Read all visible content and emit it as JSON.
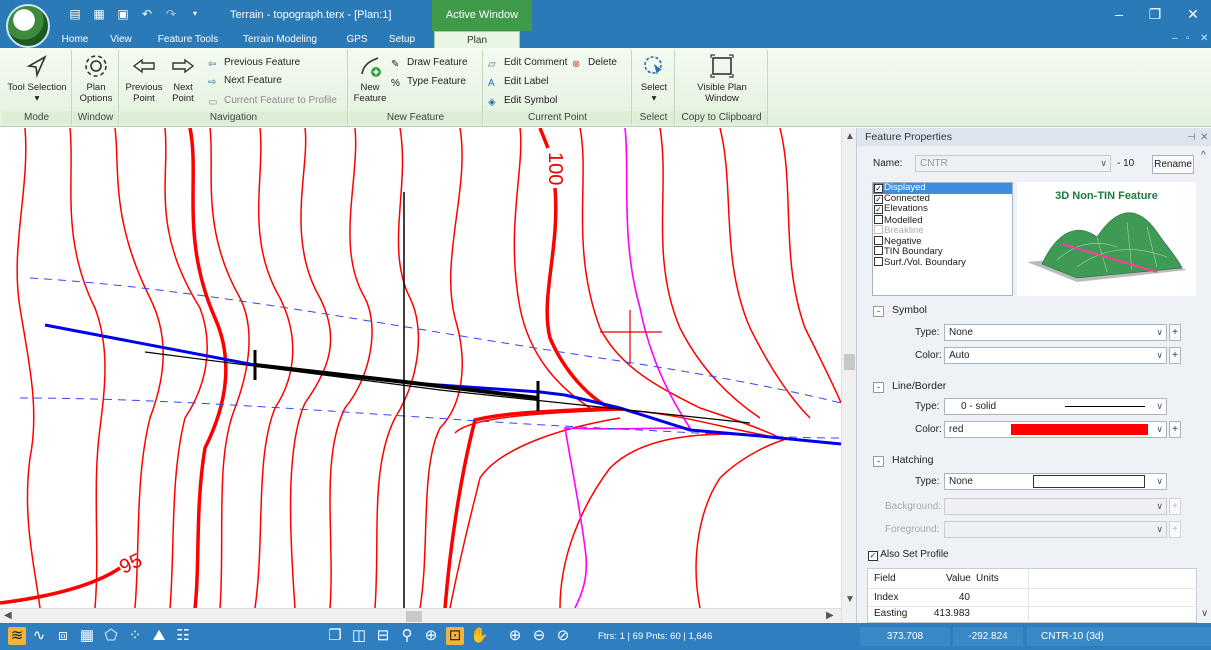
{
  "window": {
    "title": "Terrain - topograph.terx - [Plan:1]",
    "active_window_tab": "Active Window"
  },
  "ribbon_tabs": [
    {
      "label": "Home"
    },
    {
      "label": "View"
    },
    {
      "label": "Feature Tools"
    },
    {
      "label": "Terrain Modeling"
    },
    {
      "label": "GPS"
    },
    {
      "label": "Setup"
    },
    {
      "label": "Plan",
      "active": true
    }
  ],
  "ribbon": {
    "mode": {
      "label": "Mode",
      "tool_selection": "Tool Selection"
    },
    "window": {
      "label": "Window",
      "plan_options": "Plan Options"
    },
    "navigation": {
      "label": "Navigation",
      "previous_point": "Previous Point",
      "next_point": "Next Point",
      "previous_feature": "Previous Feature",
      "next_feature": "Next Feature",
      "current_feature_to_profile": "Current Feature to Profile"
    },
    "new_feature": {
      "label": "New Feature",
      "new_feature": "New Feature",
      "draw_feature": "Draw Feature",
      "type_feature": "Type Feature"
    },
    "current_point": {
      "label": "Current Point",
      "edit_comment": "Edit Comment",
      "delete": "Delete",
      "edit_label": "Edit Label",
      "edit_symbol": "Edit Symbol"
    },
    "select": {
      "label": "Select",
      "select": "Select"
    },
    "copy": {
      "label": "Copy to Clipboard",
      "visible_plan_window": "Visible Plan Window"
    }
  },
  "map": {
    "contour_labels": [
      "100",
      "95"
    ]
  },
  "feature_properties": {
    "title": "Feature Properties",
    "name_label": "Name:",
    "name_value": "CNTR",
    "name_suffix": "- 10",
    "rename": "Rename",
    "flags": [
      {
        "label": "Displayed",
        "checked": true,
        "selected": true
      },
      {
        "label": "Connected",
        "checked": true
      },
      {
        "label": "Elevations",
        "checked": true
      },
      {
        "label": "Modelled",
        "checked": false
      },
      {
        "label": "Breakline",
        "checked": false,
        "disabled": true
      },
      {
        "label": "Negative",
        "checked": false
      },
      {
        "label": "TIN Boundary",
        "checked": false
      },
      {
        "label": "Surf./Vol. Boundary",
        "checked": false
      }
    ],
    "preview_title": "3D Non-TIN Feature",
    "symbol": {
      "header": "Symbol",
      "type_label": "Type:",
      "type_value": "None",
      "color_label": "Color:",
      "color_value": "Auto"
    },
    "line_border": {
      "header": "Line/Border",
      "type_label": "Type:",
      "type_value": "0 - solid",
      "color_label": "Color:",
      "color_value": "red",
      "color_hex": "#ff0000"
    },
    "hatching": {
      "header": "Hatching",
      "type_label": "Type:",
      "type_value": "None",
      "background_label": "Background:",
      "foreground_label": "Foreground:"
    },
    "also_set_profile": "Also Set Profile",
    "table": {
      "headers": [
        "Field",
        "Value",
        "Units"
      ],
      "rows": [
        {
          "field": "Index",
          "value": "40"
        },
        {
          "field": "Easting",
          "value": "413.983"
        }
      ]
    }
  },
  "status": {
    "counts": "Ftrs: 1 | 69  Pnts: 60 | 1,646",
    "easting": "373.708",
    "northing": "-292.824",
    "feature": "CNTR-10 (3d)"
  },
  "colors": {
    "titlebar": "#2a7ab8",
    "active_window": "#3f9a4a",
    "contour": "#ff0000",
    "profile_line": "#0000ff",
    "statusbar": "#2f7fc0"
  }
}
